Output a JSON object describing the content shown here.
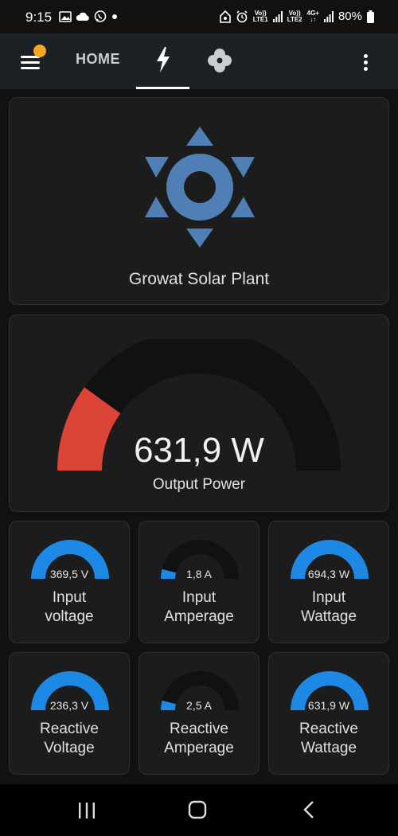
{
  "status_bar": {
    "time": "9:15",
    "battery": "80%",
    "sim1": "LTE1",
    "sim2": "LTE2",
    "volte": "Vo))",
    "net": "4G+"
  },
  "header": {
    "home_tab": "HOME",
    "active_tab": "energy",
    "tabs": [
      "menu-icon",
      "HOME",
      "lightning-icon",
      "fan-icon",
      "more-vert-icon"
    ]
  },
  "plant": {
    "title": "Growat Solar Plant",
    "icon": "sun-icon",
    "icon_color": "#4f7fb4"
  },
  "output": {
    "value": "631,9 W",
    "label": "Output Power",
    "fraction": 0.2,
    "fill_color": "#db4437",
    "track_color": "#111111"
  },
  "gauges": [
    {
      "value": "369,5 V",
      "label_line1": "Input",
      "label_line2": "voltage",
      "fraction": 1.0
    },
    {
      "value": "1,8 A",
      "label_line1": "Input",
      "label_line2": "Amperage",
      "fraction": 0.08
    },
    {
      "value": "694,3 W",
      "label_line1": "Input",
      "label_line2": "Wattage",
      "fraction": 1.0
    },
    {
      "value": "236,3 V",
      "label_line1": "Reactive",
      "label_line2": "Voltage",
      "fraction": 1.0
    },
    {
      "value": "2,5 A",
      "label_line1": "Reactive",
      "label_line2": "Amperage",
      "fraction": 0.08
    },
    {
      "value": "631,9 W",
      "label_line1": "Reactive",
      "label_line2": "Wattage",
      "fraction": 1.0
    }
  ],
  "colors": {
    "gauge_fill": "#1e88e5",
    "gauge_track": "#111111",
    "accent_badge": "#f5a623"
  },
  "nav": [
    "recent-apps-icon",
    "home-icon",
    "back-icon"
  ]
}
